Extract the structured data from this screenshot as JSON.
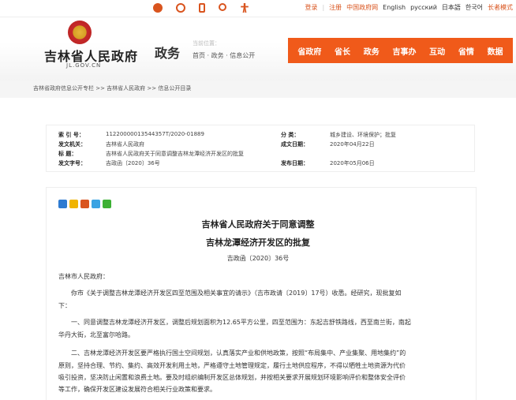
{
  "topbar": {
    "icons": [
      "wechat-icon",
      "weibo-icon",
      "mobile-icon",
      "search-icon",
      "accessibility-icon"
    ],
    "links": [
      {
        "label": "登录",
        "accent": true
      },
      {
        "label": "注册",
        "accent": true
      },
      {
        "label": "中国政府网",
        "accent": true
      },
      {
        "label": "English",
        "accent": false
      },
      {
        "label": "русский",
        "accent": false
      },
      {
        "label": "日本語",
        "accent": false
      },
      {
        "label": "한국어",
        "accent": false
      },
      {
        "label": "长者模式",
        "accent": true
      }
    ]
  },
  "header": {
    "site_title": "吉林省人民政府",
    "site_url": "JL.GOV.CN",
    "section": "政务",
    "location_label": "当前位置：",
    "location_path": "首页 · 政务 · 信息公开",
    "nav": [
      "省政府",
      "省长",
      "政务",
      "吉事办",
      "互动",
      "省情",
      "数据"
    ]
  },
  "breadcrumb": "吉林省政府信息公开专栏 >> 吉林省人民政府 >> 信息公开目录",
  "info": {
    "index_label": "索  引  号：",
    "index_value": "11220000013544357T/2020-01889",
    "issuer_label": "发文机关：",
    "issuer_value": "吉林省人民政府",
    "title_label": "标      题：",
    "title_value": "吉林省人民政府关于同意调整吉林龙潭经济开发区的批复",
    "docno_label": "发文字号：",
    "docno_value": "吉政函〔2020〕36号",
    "category_label": "分      类：",
    "category_value": "城乡建设、环境保护；批复",
    "created_label": "成文日期：",
    "created_value": "2020年04月22日",
    "published_label": "发布日期：",
    "published_value": "2020年05月06日"
  },
  "share_colors": [
    "#2e7bd1",
    "#f0b400",
    "#d9541e",
    "#3aa3e3",
    "#3cb034"
  ],
  "document": {
    "title_line1": "吉林省人民政府关于同意调整",
    "title_line2": "吉林龙潭经济开发区的批复",
    "number": "吉政函〔2020〕36号",
    "addressee": "吉林市人民政府：",
    "para1_line1": "你市《关于调整吉林龙潭经济开发区四至范围及相关事宜的请示》（吉市政请〔2019〕17号）收悉。经研究，现批复如",
    "para1_line2": "下：",
    "para2_line1": "一、同意调整吉林龙潭经济开发区，调整后规划面积为12.65平方公里，四至范围为：东起吉舒铁路线，西至南兰街，南起",
    "para2_line2": "华丹大街，北至富尔哈路。",
    "para3_line1": "二、吉林龙潭经济开发区要严格执行国土空间规划，认真落实产业和供地政策，按照“布局集中、产业集聚、用地集约”的",
    "para3_line2": "原则，坚持合理、节约、集约、高效开发利用土地，严格遵守土地管理规定，履行土地供应程序，不得以牺牲土地资源为代价",
    "para3_line3": "吸引投资，坚决防止闲置和浪费土地。要及时组织编制开发区总体规划，并按相关要求开展规划环境影响评价和整体安全评价",
    "para3_line4": "等工作，确保开发区建设发展符合相关行业政策和要求。"
  }
}
